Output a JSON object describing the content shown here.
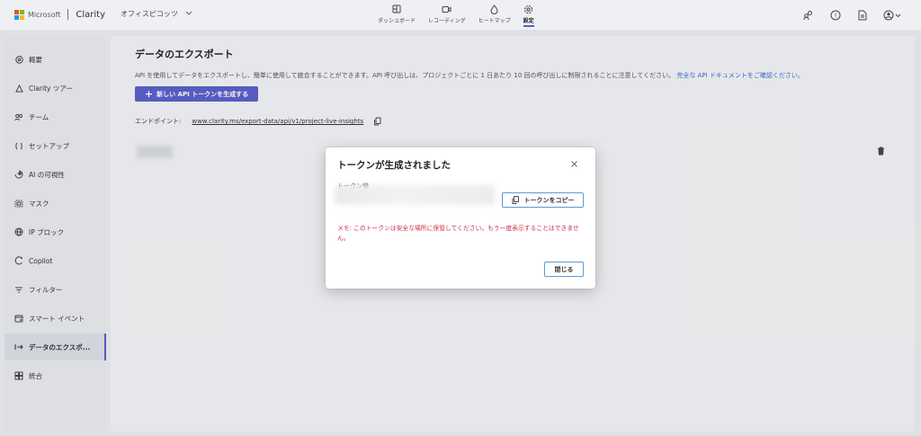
{
  "header": {
    "brand": "Microsoft",
    "app_name": "Clarity",
    "project_name": "オフィスピコッツ",
    "nav": [
      {
        "label": "ダッシュボード",
        "icon": "dashboard-icon"
      },
      {
        "label": "レコーディング",
        "icon": "video-icon"
      },
      {
        "label": "ヒートマップ",
        "icon": "flame-icon"
      },
      {
        "label": "設定",
        "icon": "gear-icon",
        "active": true
      }
    ],
    "right_icons": [
      "people-icon",
      "help-icon",
      "document-icon",
      "account-icon"
    ],
    "colors": {
      "accent": "#5b5fc7",
      "ms_red": "#f25022",
      "ms_green": "#7fba00",
      "ms_blue": "#00a4ef",
      "ms_yellow": "#ffb900"
    }
  },
  "sidebar": {
    "items": [
      {
        "label": "概要",
        "icon": "overview-icon"
      },
      {
        "label": "Clarity ツアー",
        "icon": "tour-icon"
      },
      {
        "label": "チーム",
        "icon": "team-icon"
      },
      {
        "label": "セットアップ",
        "icon": "code-icon"
      },
      {
        "label": "AI の可視性",
        "icon": "ai-icon"
      },
      {
        "label": "マスク",
        "icon": "mask-icon"
      },
      {
        "label": "IP ブロック",
        "icon": "globe-icon"
      },
      {
        "label": "Copilot",
        "icon": "copilot-icon"
      },
      {
        "label": "フィルター",
        "icon": "filter-icon"
      },
      {
        "label": "スマート イベント",
        "icon": "event-icon"
      },
      {
        "label": "データのエクスポ...",
        "icon": "export-icon",
        "active": true
      },
      {
        "label": "統合",
        "icon": "grid-icon"
      }
    ]
  },
  "main": {
    "title": "データのエクスポート",
    "description": "API を使用してデータをエクスポートし、簡単に使用して統合することができます。API 呼び出しは、プロジェクトごとに 1 日あたり 10 回の呼び出しに制限されることに注意してください。",
    "description_link": "完全な API ドキュメントをご確認ください。",
    "generate_button": "新しい API トークンを生成する",
    "endpoint_label": "エンドポイント:",
    "endpoint_url": "www.clarity.ms/export-data/api/v1/project-live-insights"
  },
  "modal": {
    "title": "トークンが生成されました",
    "token_label": "トークン値",
    "copy_button": "トークンをコピー",
    "warning": "メモ: このトークンは安全な場所に保管してください。もう一度表示することはできません。",
    "close_button": "閉じる"
  }
}
